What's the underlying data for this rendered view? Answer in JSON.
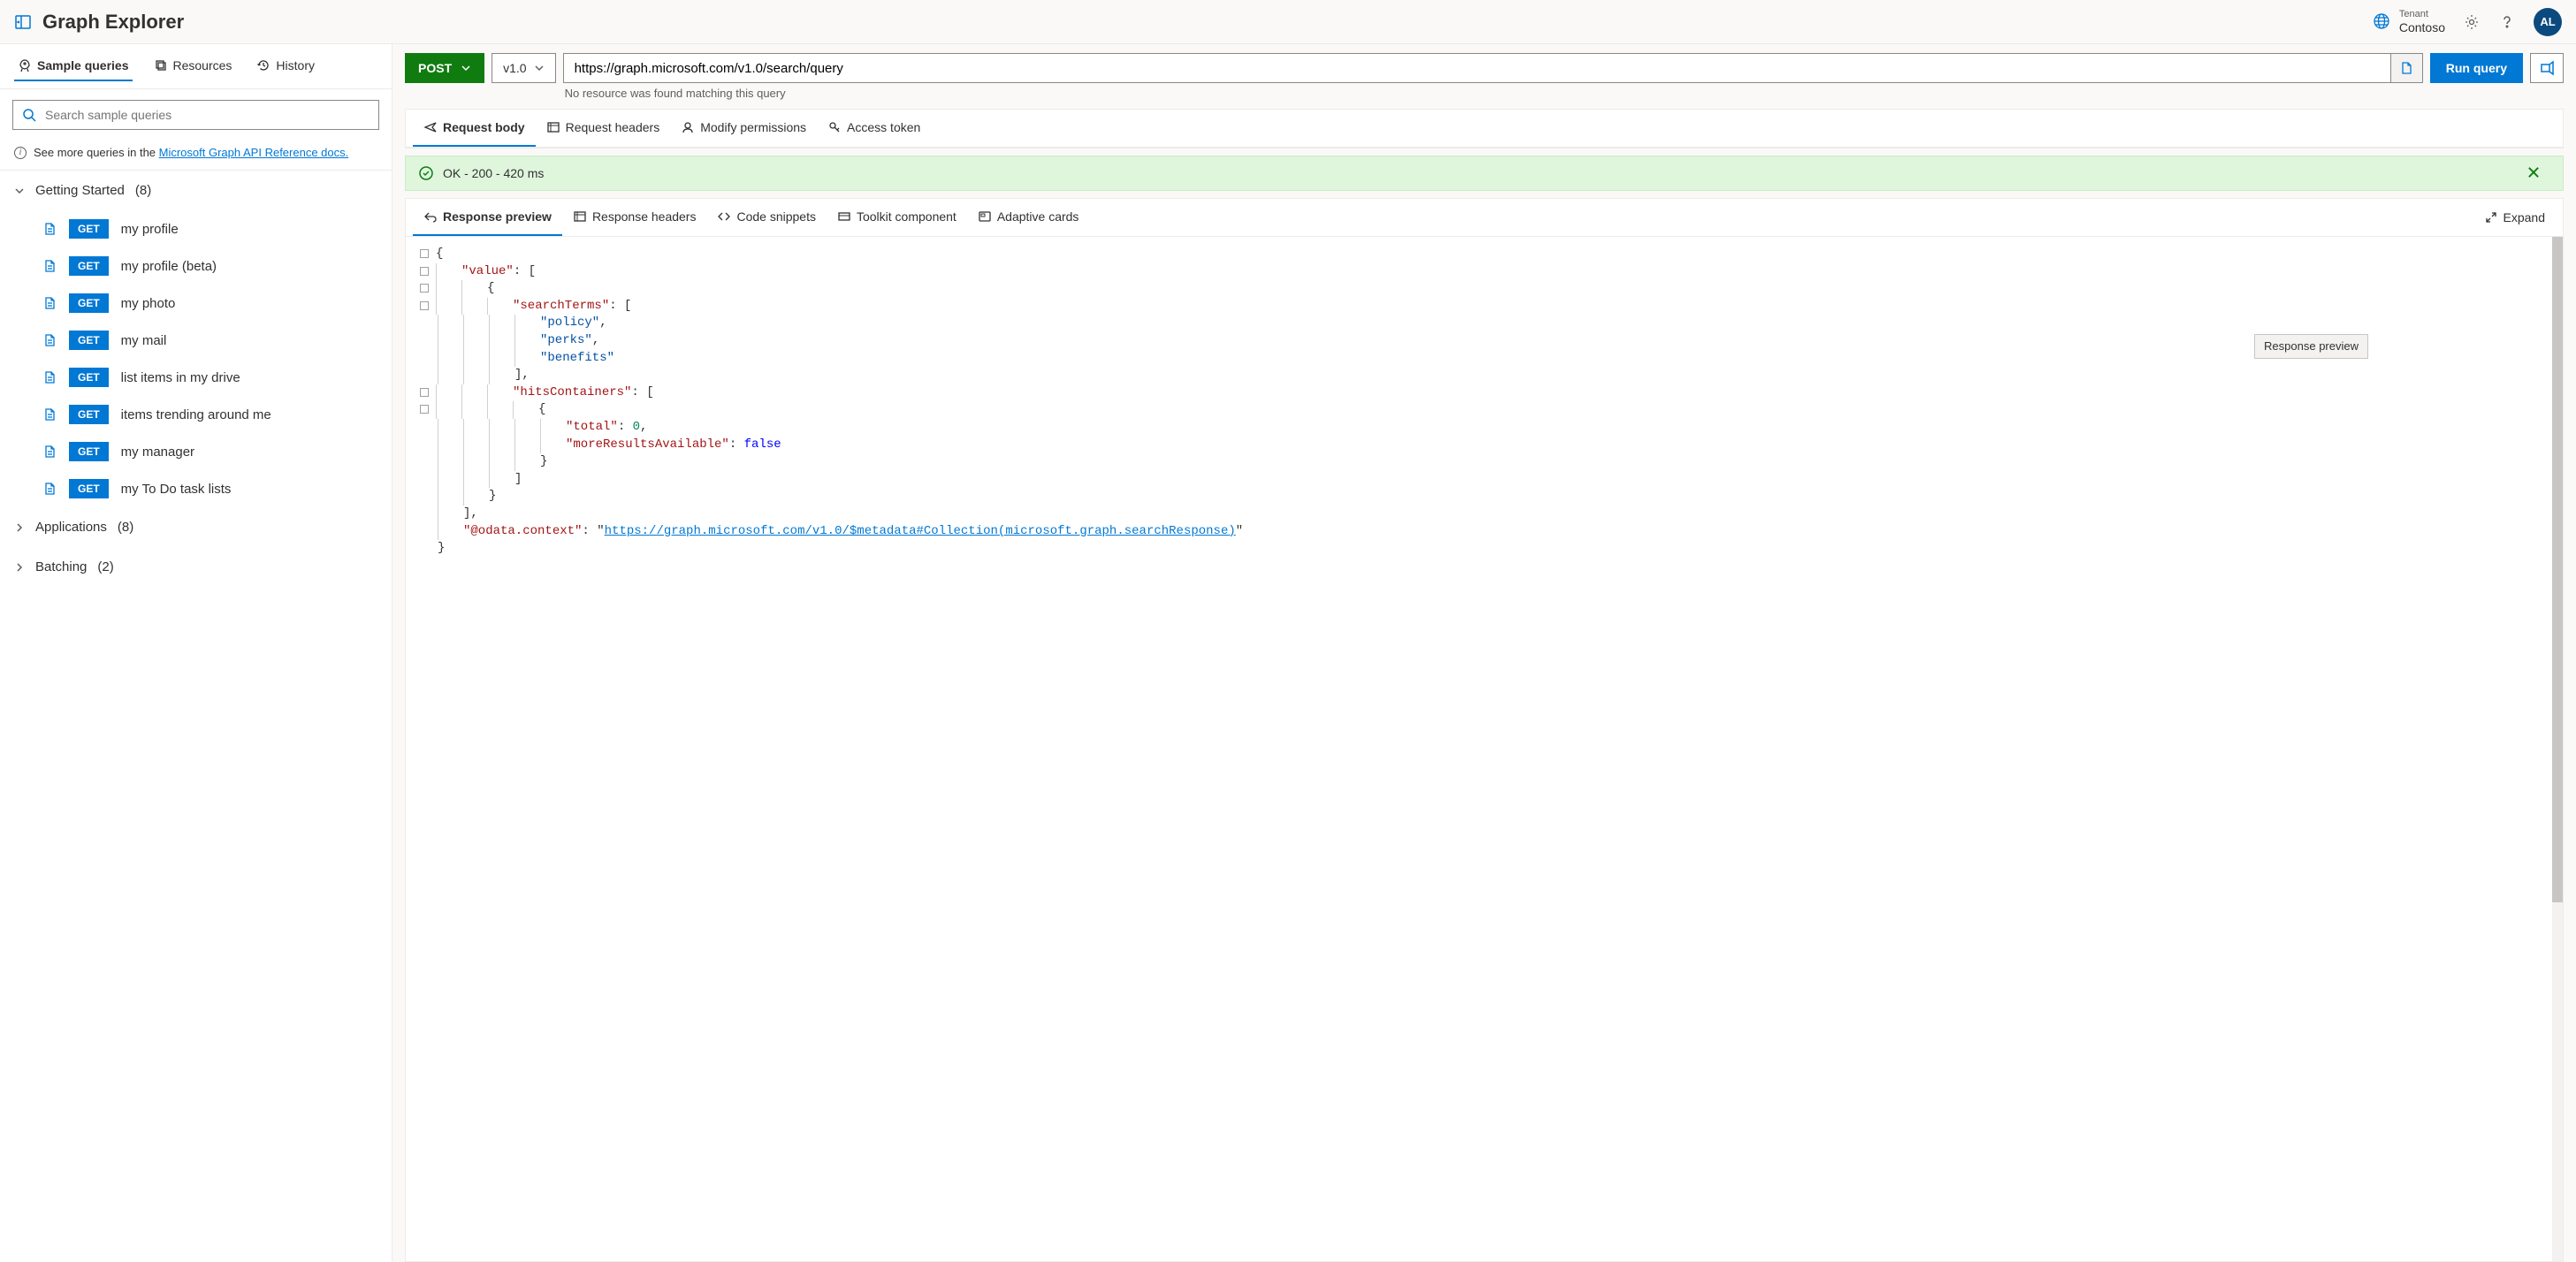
{
  "header": {
    "app_title": "Graph Explorer",
    "tenant_label": "Tenant",
    "tenant_name": "Contoso",
    "avatar_initials": "AL"
  },
  "sidebar": {
    "tabs": [
      {
        "label": "Sample queries",
        "icon": "rocket",
        "active": true
      },
      {
        "label": "Resources",
        "icon": "layers",
        "active": false
      },
      {
        "label": "History",
        "icon": "history",
        "active": false
      }
    ],
    "search_placeholder": "Search sample queries",
    "info_prefix": "See more queries in the ",
    "info_link": "Microsoft Graph API Reference docs.",
    "categories": [
      {
        "name": "Getting Started",
        "count": "(8)",
        "expanded": true,
        "items": [
          {
            "method": "GET",
            "label": "my profile"
          },
          {
            "method": "GET",
            "label": "my profile (beta)"
          },
          {
            "method": "GET",
            "label": "my photo"
          },
          {
            "method": "GET",
            "label": "my mail"
          },
          {
            "method": "GET",
            "label": "list items in my drive"
          },
          {
            "method": "GET",
            "label": "items trending around me"
          },
          {
            "method": "GET",
            "label": "my manager"
          },
          {
            "method": "GET",
            "label": "my To Do task lists"
          }
        ]
      },
      {
        "name": "Applications",
        "count": "(8)",
        "expanded": false,
        "items": []
      },
      {
        "name": "Batching",
        "count": "(2)",
        "expanded": false,
        "items": []
      }
    ]
  },
  "query": {
    "method": "POST",
    "version": "v1.0",
    "url": "https://graph.microsoft.com/v1.0/search/query",
    "hint": "No resource was found matching this query",
    "run_label": "Run query"
  },
  "request_tabs": [
    {
      "label": "Request body",
      "icon": "send",
      "active": true
    },
    {
      "label": "Request headers",
      "icon": "headers",
      "active": false
    },
    {
      "label": "Modify permissions",
      "icon": "permissions",
      "active": false
    },
    {
      "label": "Access token",
      "icon": "key",
      "active": false
    }
  ],
  "status": {
    "text": "OK - 200 - 420 ms"
  },
  "response_tabs": [
    {
      "label": "Response preview",
      "icon": "undo",
      "active": true
    },
    {
      "label": "Response headers",
      "icon": "headers",
      "active": false
    },
    {
      "label": "Code snippets",
      "icon": "code",
      "active": false
    },
    {
      "label": "Toolkit component",
      "icon": "toolkit",
      "active": false
    },
    {
      "label": "Adaptive cards",
      "icon": "card",
      "active": false
    }
  ],
  "expand_label": "Expand",
  "tooltip_text": "Response preview",
  "response_json": {
    "value_key": "\"value\"",
    "searchTerms_key": "\"searchTerms\"",
    "terms": [
      "\"policy\"",
      "\"perks\"",
      "\"benefits\""
    ],
    "hitsContainers_key": "\"hitsContainers\"",
    "total_key": "\"total\"",
    "total_val": "0",
    "more_key": "\"moreResultsAvailable\"",
    "more_val": "false",
    "context_key": "\"@odata.context\"",
    "context_val": "https://graph.microsoft.com/v1.0/$metadata#Collection(microsoft.graph.searchResponse)"
  }
}
